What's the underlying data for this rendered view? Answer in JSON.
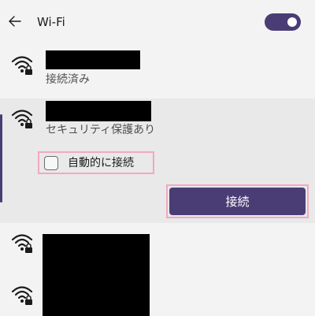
{
  "header": {
    "title": "Wi-Fi",
    "back_icon": "back-arrow-icon",
    "toggle_on": true
  },
  "networks": [
    {
      "name": "",
      "status": "接続済み",
      "icon": "wifi-secured-icon"
    },
    {
      "name": "",
      "status": "セキュリティ保護あり",
      "icon": "wifi-secured-icon",
      "auto_connect_label": "自動的に接続",
      "auto_connect_checked": false,
      "connect_label": "接続"
    },
    {
      "name": "",
      "status": "",
      "icon": "wifi-secured-icon"
    },
    {
      "name": "",
      "status": "",
      "icon": "wifi-secured-icon"
    }
  ],
  "colors": {
    "accent": "#4a3d75",
    "highlight_border": "#f2a7c3",
    "background": "#f3f3f3",
    "selected_background": "#e9e9e9",
    "redaction": "#000000"
  }
}
